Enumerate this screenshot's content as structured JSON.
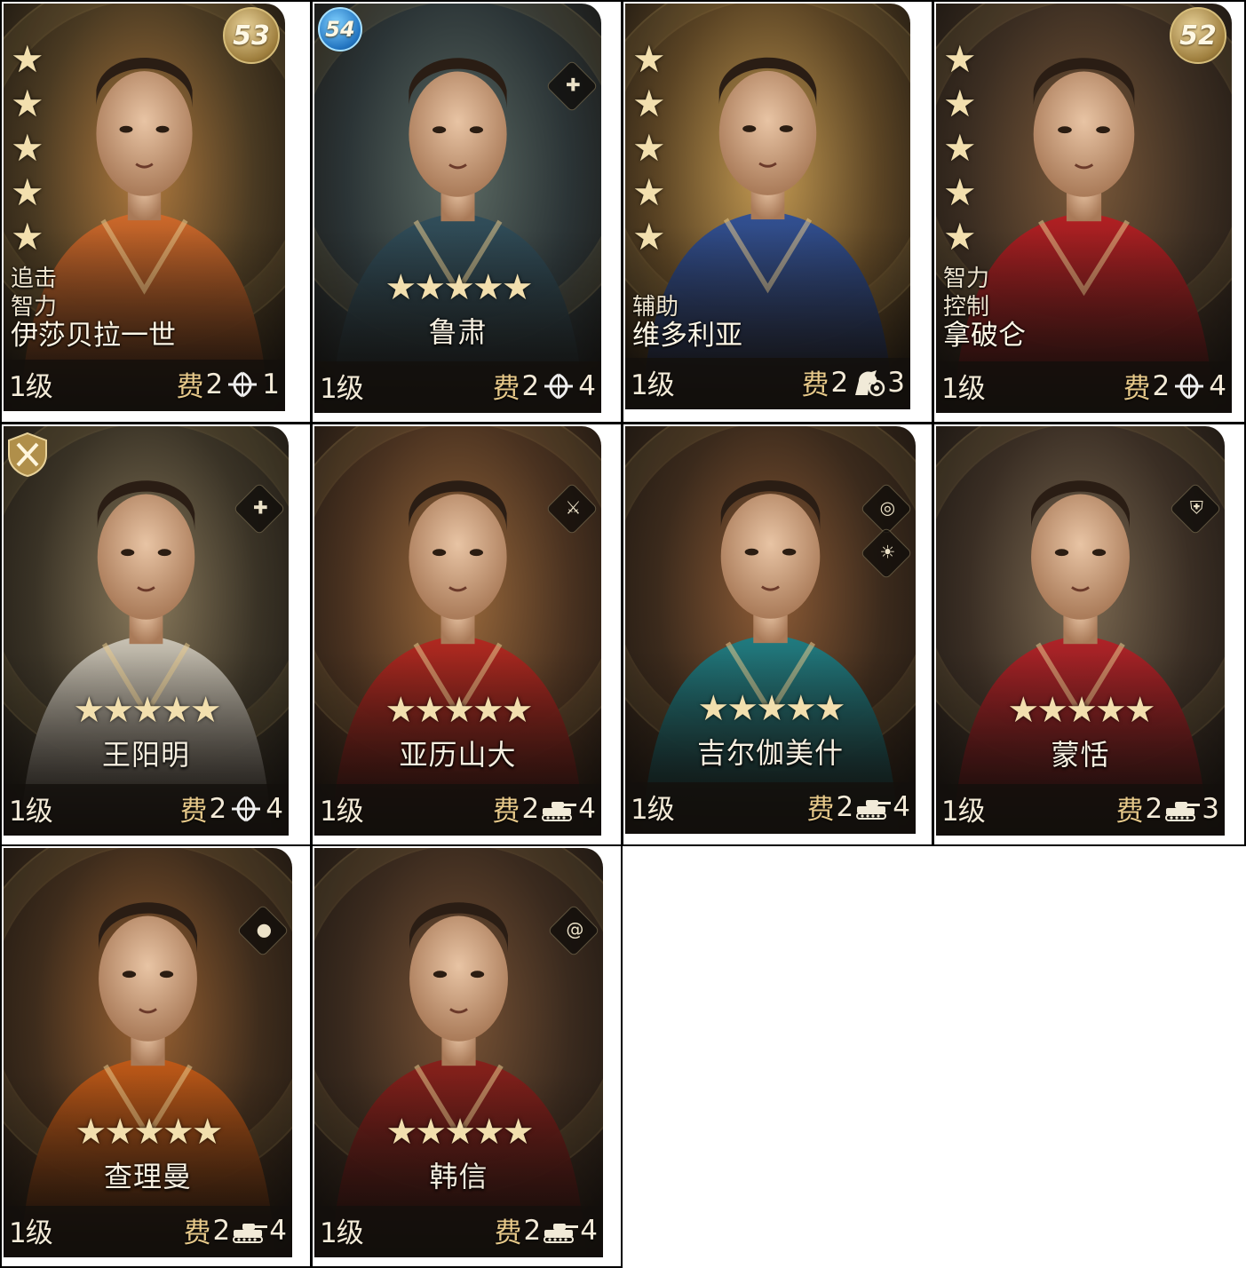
{
  "cards": [
    {
      "name": "伊莎贝拉一世",
      "level": "1级",
      "cost_label": "费",
      "cost": "2",
      "unit_icon": "bow-icon",
      "unit_count": "1",
      "stars": "★★★★★",
      "layout": "vertical",
      "tags": [
        "追击",
        "智力"
      ],
      "badge": "53",
      "badge_style": "gold",
      "colors": {
        "c1": "#4a3a22",
        "c2": "#b07a3e",
        "accent": "#d36a2a"
      }
    },
    {
      "name": "鲁肃",
      "level": "1级",
      "cost_label": "费",
      "cost": "2",
      "unit_icon": "bow-icon",
      "unit_count": "4",
      "stars": "★★★★★",
      "layout": "horizontal",
      "badge": "54",
      "badge_style": "blue",
      "skill_icons": [
        "shield-plus-icon"
      ],
      "colors": {
        "c1": "#2b3436",
        "c2": "#5d6b64",
        "accent": "#2f4e5c"
      }
    },
    {
      "name": "维多利亚",
      "level": "1级",
      "cost_label": "费",
      "cost": "2",
      "unit_icon": "horse-icon",
      "unit_count": "3",
      "stars": "★★★★★",
      "layout": "vertical",
      "tags": [
        "辅助"
      ],
      "colors": {
        "c1": "#5b4424",
        "c2": "#c49a52",
        "accent": "#2c4f9a"
      }
    },
    {
      "name": "拿破仑",
      "level": "1级",
      "cost_label": "费",
      "cost": "2",
      "unit_icon": "bow-icon",
      "unit_count": "4",
      "stars": "★★★★★",
      "layout": "vertical",
      "tags": [
        "智力",
        "控制"
      ],
      "badge": "52",
      "badge_style": "gold",
      "colors": {
        "c1": "#3c2e22",
        "c2": "#7c5a3a",
        "accent": "#b81d22"
      }
    },
    {
      "name": "王阳明",
      "level": "1级",
      "cost_label": "费",
      "cost": "2",
      "unit_icon": "bow-icon",
      "unit_count": "4",
      "stars": "★★★★★",
      "layout": "horizontal",
      "shield": true,
      "skill_icons": [
        "shield-plus-icon"
      ],
      "colors": {
        "c1": "#3a3326",
        "c2": "#8a7a5c",
        "accent": "#cfc9bb"
      }
    },
    {
      "name": "亚历山大",
      "level": "1级",
      "cost_label": "费",
      "cost": "2",
      "unit_icon": "tank-icon",
      "unit_count": "4",
      "stars": "★★★★★",
      "layout": "horizontal",
      "skill_icons": [
        "sword-icon"
      ],
      "colors": {
        "c1": "#4a3220",
        "c2": "#9b6a3c",
        "accent": "#b5261f"
      }
    },
    {
      "name": "吉尔伽美什",
      "level": "1级",
      "cost_label": "费",
      "cost": "2",
      "unit_icon": "tank-icon",
      "unit_count": "4",
      "stars": "★★★★★",
      "layout": "horizontal",
      "skill_icons": [
        "target-icon",
        "bulb-icon"
      ],
      "colors": {
        "c1": "#3b2a1c",
        "c2": "#8e5c36",
        "accent": "#1c7f86"
      }
    },
    {
      "name": "蒙恬",
      "level": "1级",
      "cost_label": "费",
      "cost": "2",
      "unit_icon": "tank-icon",
      "unit_count": "3",
      "stars": "★★★★★",
      "layout": "horizontal",
      "skill_icons": [
        "shield-icon"
      ],
      "colors": {
        "c1": "#3a2e24",
        "c2": "#7c6a52",
        "accent": "#b52026"
      }
    },
    {
      "name": "查理曼",
      "level": "1级",
      "cost_label": "费",
      "cost": "2",
      "unit_icon": "tank-icon",
      "unit_count": "4",
      "stars": "★★★★★",
      "layout": "horizontal",
      "skill_icons": [
        "head-icon"
      ],
      "colors": {
        "c1": "#3e2c1c",
        "c2": "#9a6232",
        "accent": "#c45a16"
      }
    },
    {
      "name": "韩信",
      "level": "1级",
      "cost_label": "费",
      "cost": "2",
      "unit_icon": "tank-icon",
      "unit_count": "4",
      "stars": "★★★★★",
      "layout": "horizontal",
      "skill_icons": [
        "spiral-icon"
      ],
      "colors": {
        "c1": "#3a2a1e",
        "c2": "#7a5436",
        "accent": "#8a1e1a"
      }
    }
  ]
}
